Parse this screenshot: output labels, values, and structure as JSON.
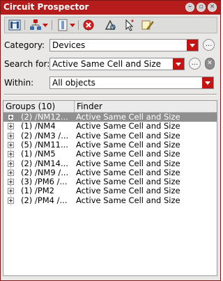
{
  "window": {
    "title": "Circuit Prospector"
  },
  "title_buttons": [
    {
      "name": "minimize-window-button",
      "glyph": "–"
    },
    {
      "name": "restore-window-button",
      "glyph": "▫"
    },
    {
      "name": "close-window-button",
      "glyph": "✕"
    }
  ],
  "toolbar": {
    "icons": [
      "find-icon",
      "group-icon",
      "group-menu-arrow",
      "panel-icon",
      "panel-menu-arrow",
      "stop-icon",
      "probe-icon",
      "select-icon",
      "assign-icon"
    ]
  },
  "form": {
    "category_label": "Category:",
    "category_value": "Devices",
    "search_label": "Search for:",
    "search_value": "Active Same Cell and Size",
    "within_label": "Within:",
    "within_value": "All objects",
    "ellipsis": "...",
    "clear": "✕"
  },
  "table": {
    "columns": [
      "Groups (10)",
      "Finder"
    ],
    "rows": [
      {
        "group": "(2)  /NM12...",
        "finder": "Active Same Cell and Size",
        "selected": true
      },
      {
        "group": "(1)  /NM4",
        "finder": "Active Same Cell and Size",
        "selected": false
      },
      {
        "group": "(2)  /NM3 /...",
        "finder": "Active Same Cell and Size",
        "selected": false
      },
      {
        "group": "(5)  /NM11...",
        "finder": "Active Same Cell and Size",
        "selected": false
      },
      {
        "group": "(1)  /NM5",
        "finder": "Active Same Cell and Size",
        "selected": false
      },
      {
        "group": "(2)  /NM14...",
        "finder": "Active Same Cell and Size",
        "selected": false
      },
      {
        "group": "(2)  /NM9 /...",
        "finder": "Active Same Cell and Size",
        "selected": false
      },
      {
        "group": "(3)  /PM6 /...",
        "finder": "Active Same Cell and Size",
        "selected": false
      },
      {
        "group": "(1)  /PM2",
        "finder": "Active Same Cell and Size",
        "selected": false
      },
      {
        "group": "(2)  /PM4 /...",
        "finder": "Active Same Cell and Size",
        "selected": false
      }
    ]
  }
}
